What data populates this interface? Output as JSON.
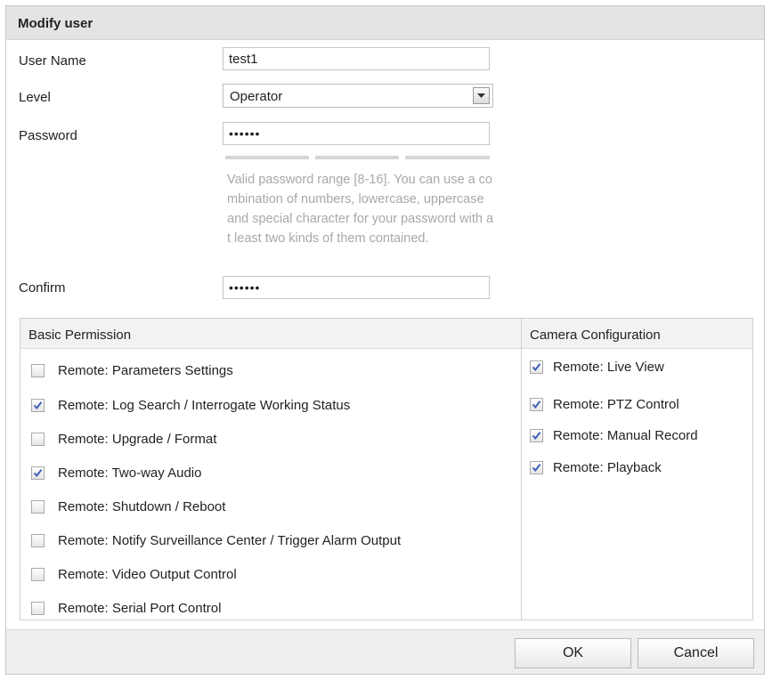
{
  "dialog": {
    "title": "Modify user"
  },
  "form": {
    "username_label": "User Name",
    "username_value": "test1",
    "level_label": "Level",
    "level_value": "Operator",
    "password_label": "Password",
    "password_value": "••••••",
    "password_hint": "Valid password range [8-16]. You can use a combination of numbers, lowercase, uppercase and special character for your password with at least two kinds of them contained.",
    "confirm_label": "Confirm",
    "confirm_value": "••••••"
  },
  "basic_permission": {
    "header": "Basic Permission",
    "items": [
      {
        "label": "Remote: Parameters Settings",
        "checked": false
      },
      {
        "label": "Remote: Log Search / Interrogate Working Status",
        "checked": true
      },
      {
        "label": "Remote: Upgrade / Format",
        "checked": false
      },
      {
        "label": "Remote: Two-way Audio",
        "checked": true
      },
      {
        "label": "Remote: Shutdown / Reboot",
        "checked": false
      },
      {
        "label": "Remote: Notify Surveillance Center / Trigger Alarm Output",
        "checked": false
      },
      {
        "label": "Remote: Video Output Control",
        "checked": false
      },
      {
        "label": "Remote: Serial Port Control",
        "checked": false
      }
    ]
  },
  "camera_configuration": {
    "header": "Camera Configuration",
    "items": [
      {
        "label": "Remote: Live View",
        "checked": true
      },
      {
        "label": "Remote: PTZ Control",
        "checked": true
      },
      {
        "label": "Remote: Manual Record",
        "checked": true
      },
      {
        "label": "Remote: Playback",
        "checked": true
      }
    ]
  },
  "buttons": {
    "ok_label": "OK",
    "cancel_label": "Cancel"
  },
  "colors": {
    "titlebar": "#e4e4e4",
    "hint_text": "#a8a8a8",
    "check": "#3d5fb6"
  }
}
